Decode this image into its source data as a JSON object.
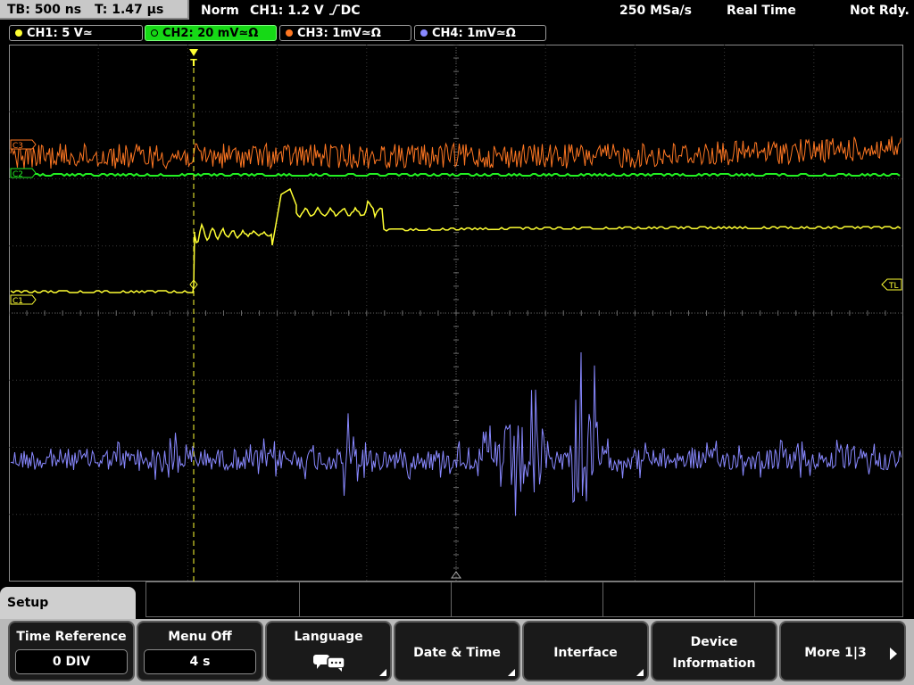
{
  "topbar": {
    "timebase": "TB: 500 ns",
    "trigger_time": "T: 1.47 µs",
    "mode": "Norm",
    "trigger_setting": "CH1: 1.2 V",
    "coupling": "DC",
    "sample_rate": "250 MSa/s",
    "acq_mode": "Real Time",
    "status": "Not Rdy."
  },
  "channels": [
    {
      "label": "CH1: 5 V≃",
      "color": "#ffff33",
      "active": false
    },
    {
      "label": "CH2: 20 mV≃Ω",
      "color": "#22ee22",
      "active": true
    },
    {
      "label": "CH3: 1mV≃Ω",
      "color": "#ff7722",
      "active": false
    },
    {
      "label": "CH4: 1mV≃Ω",
      "color": "#8888ff",
      "active": false
    }
  ],
  "markers": {
    "ch3": "C3",
    "ch2": "C2",
    "ch1": "C1",
    "trigger_level": "TL",
    "trigger_pos": "T"
  },
  "menu": {
    "title": "Setup",
    "softkeys": [
      {
        "label": "Time Reference",
        "value": "0 DIV"
      },
      {
        "label": "Menu Off",
        "value": "4 s"
      },
      {
        "label": "Language",
        "icon": "speech-bubble-icon"
      },
      {
        "label": "Date & Time"
      },
      {
        "label": "Interface"
      },
      {
        "label": "Device",
        "label2": "Information"
      },
      {
        "label": "More 1|3"
      }
    ]
  }
}
